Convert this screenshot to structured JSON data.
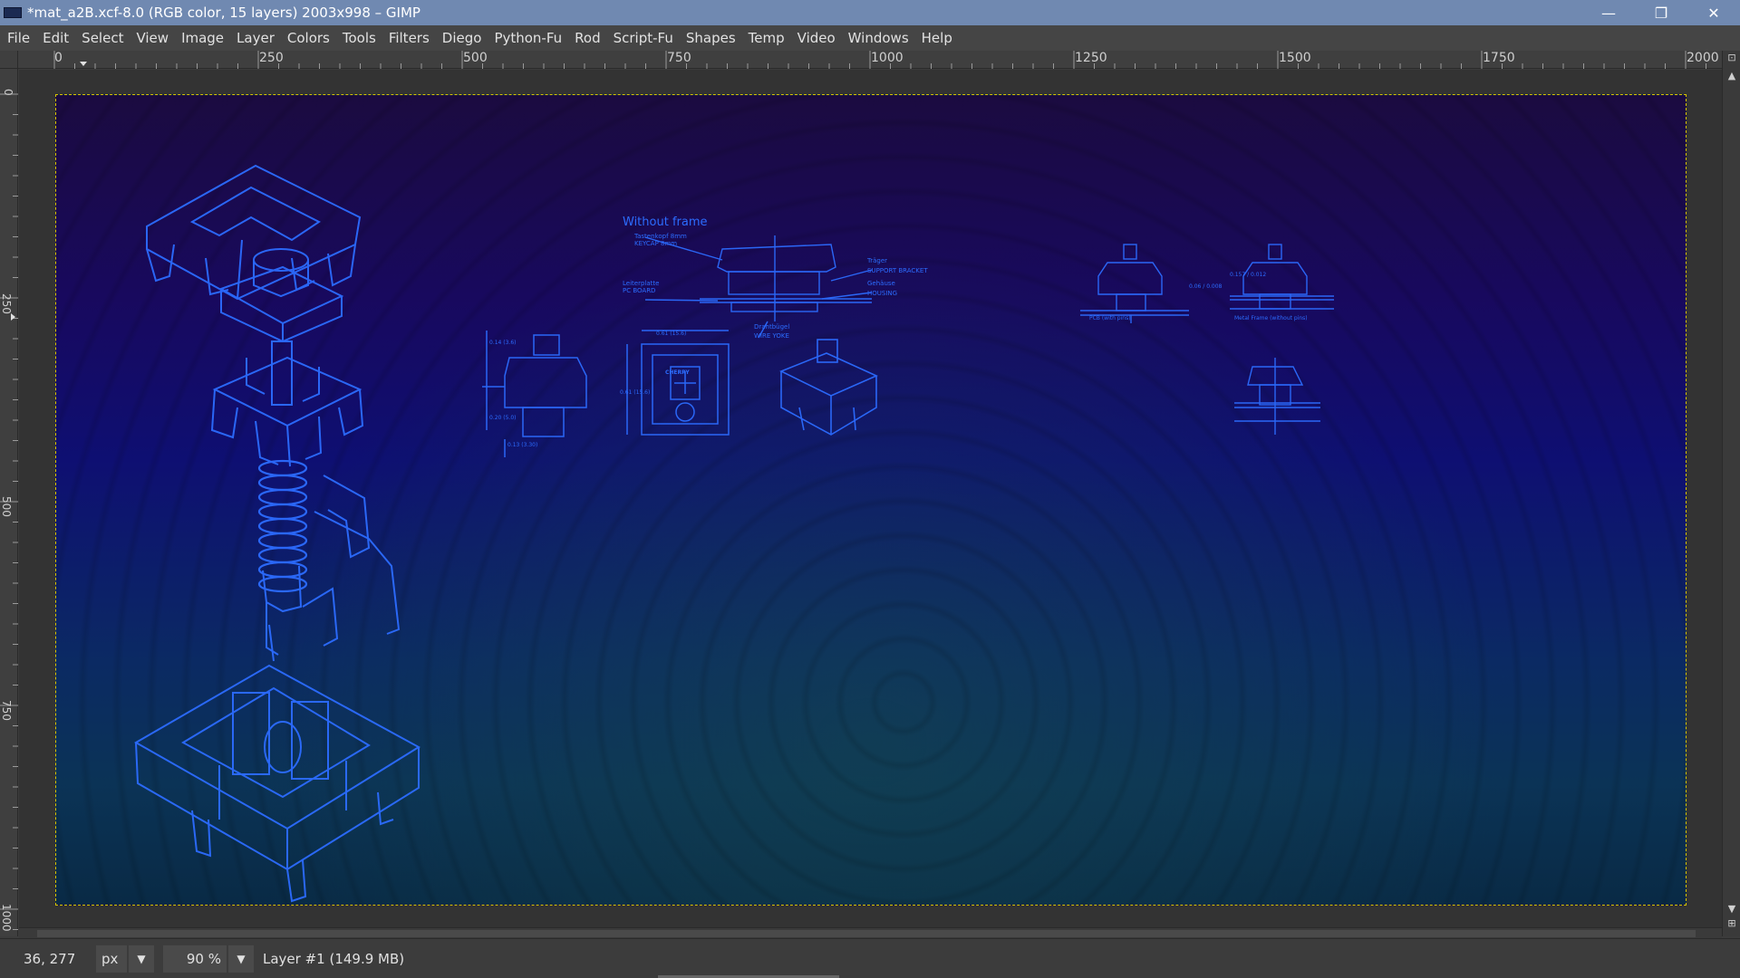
{
  "window": {
    "title": "*mat_a2B.xcf-8.0 (RGB color, 15 layers) 2003x998 – GIMP",
    "controls": [
      "—",
      "❐",
      "✕"
    ]
  },
  "menu": [
    "File",
    "Edit",
    "Select",
    "View",
    "Image",
    "Layer",
    "Colors",
    "Tools",
    "Filters",
    "Diego",
    "Python-Fu",
    "Rod",
    "Script-Fu",
    "Shapes",
    "Temp",
    "Video",
    "Windows",
    "Help"
  ],
  "rulers": {
    "horizontal": [
      "0",
      "250",
      "500",
      "750",
      "1000",
      "1250",
      "1500",
      "1750",
      "2000"
    ],
    "vertical": [
      "0",
      "250",
      "500",
      "750",
      "1000"
    ]
  },
  "canvas": {
    "annotations": {
      "without_frame": "Without frame",
      "keycap_de": "Tastenkopf 8mm",
      "keycap": "KEYCAP 8mm",
      "pcb_de": "Leiterplatte",
      "pcb": "PC BOARD",
      "bracket_de": "Träger",
      "bracket": "SUPPORT BRACKET",
      "housing_de": "Gehäuse",
      "housing": "HOUSING",
      "yoke_de": "Drahtbügel",
      "yoke": "WIRE YOKE",
      "dim_a": "0.14 (3.6)",
      "dim_b": "0.61 (15.6)",
      "dim_c": "0.61 (15.6)",
      "dim_d": "0.20 (5.0)",
      "dim_e": "0.13 (3.30)",
      "cherry": "CHERRY",
      "pcb_with_pins": "PCB (with pins)",
      "metal_frame": "Metal Frame (without pins)",
      "pcb_dim": "0.06 / 0.008",
      "frame_dim": "0.157 / 0.012"
    }
  },
  "status": {
    "coords": "36, 277",
    "unit": "px",
    "zoom": "90 %",
    "layer": "Layer #1 (149.9 MB)"
  },
  "colors": {
    "titlebar": "#7089b1",
    "menubar": "#454545",
    "blueprint_line": "#2c6cff",
    "selection": "#d8c400"
  }
}
